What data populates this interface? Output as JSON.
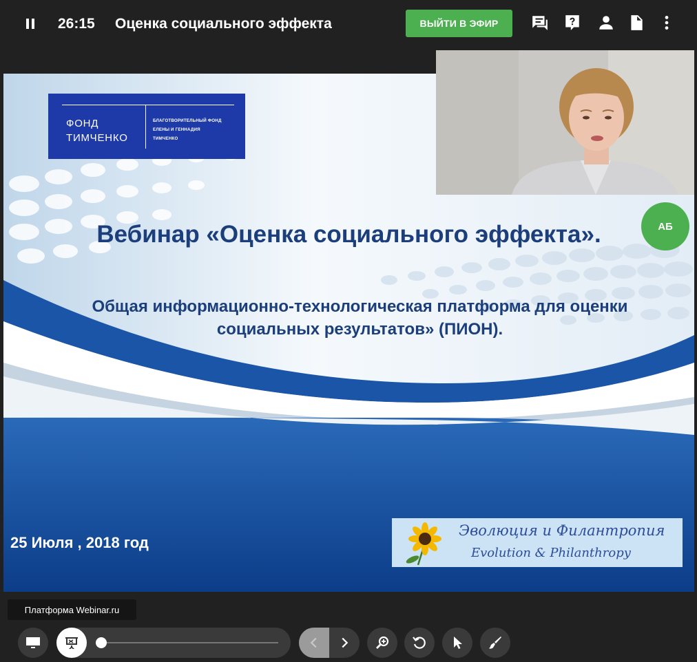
{
  "header": {
    "timer": "26:15",
    "title": "Оценка социального эффекта",
    "live_button": "ВЫЙТИ В ЭФИР",
    "icons": [
      "pause-icon",
      "chat-icon",
      "question-icon",
      "person-icon",
      "document-icon",
      "more-vertical-icon"
    ]
  },
  "slide": {
    "logo_text_line1": "ФОНД",
    "logo_text_line2": "ТИМЧЕНКО",
    "logo_small_line1": "БЛАГОТВОРИТЕЛЬНЫЙ ФОНД",
    "logo_small_line2": "ЕЛЕНЫ И ГЕННАДИЯ",
    "logo_small_line3": "ТИМЧЕНКО",
    "heading": "Вебинар «Оценка социального эффекта».",
    "subtitle_line1": "Общая информационно-технологическая платформа для оценки",
    "subtitle_line2": "социальных результатов» (ПИОН).",
    "date": "25  Июля , 2018 год",
    "banner_ru": "Эволюция и Филантропия",
    "banner_en": "Evolution & Philanthropy"
  },
  "presenter": {
    "initials": "АБ"
  },
  "tooltip": {
    "text": "Платформа Webinar.ru"
  },
  "toolbar": {
    "progress": 0.02,
    "icons": [
      "screen-icon",
      "presentation-icon",
      "chevron-left-icon",
      "chevron-right-icon",
      "zoom-icon",
      "rotate-icon",
      "pointer-icon",
      "brush-icon"
    ]
  },
  "colors": {
    "background": "#212121",
    "accent_green": "#4caf50",
    "slide_text": "#1c3f7c",
    "logo_blue": "#1e3aa8"
  }
}
